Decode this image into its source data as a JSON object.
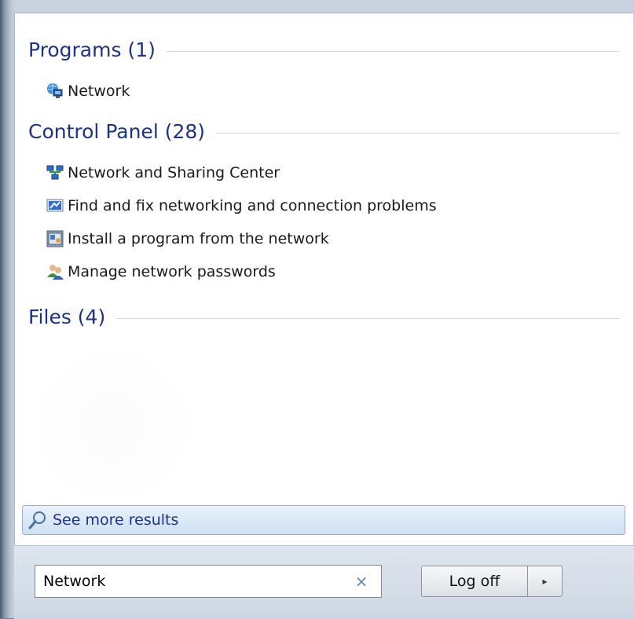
{
  "groups": {
    "programs": {
      "title": "Programs (1)"
    },
    "control_panel": {
      "title": "Control Panel (28)"
    },
    "files": {
      "title": "Files (4)"
    }
  },
  "programs": [
    {
      "label": "Network",
      "icon": "network-globe-icon"
    }
  ],
  "control_panel_items": [
    {
      "label": "Network and Sharing Center",
      "icon": "network-center-icon"
    },
    {
      "label": "Find and fix networking and connection problems",
      "icon": "troubleshoot-icon"
    },
    {
      "label": "Install a program from the network",
      "icon": "install-program-icon"
    },
    {
      "label": "Manage network passwords",
      "icon": "users-icon"
    }
  ],
  "see_more": {
    "label": "See more results",
    "icon": "magnifier-icon"
  },
  "search": {
    "value": "Network",
    "clear": "×"
  },
  "power": {
    "label": "Log off",
    "arrow": "▸"
  },
  "colors": {
    "header_text": "#1e3287",
    "see_more_border": "#8eb1dc",
    "footer_bg": "#d4dde8"
  }
}
